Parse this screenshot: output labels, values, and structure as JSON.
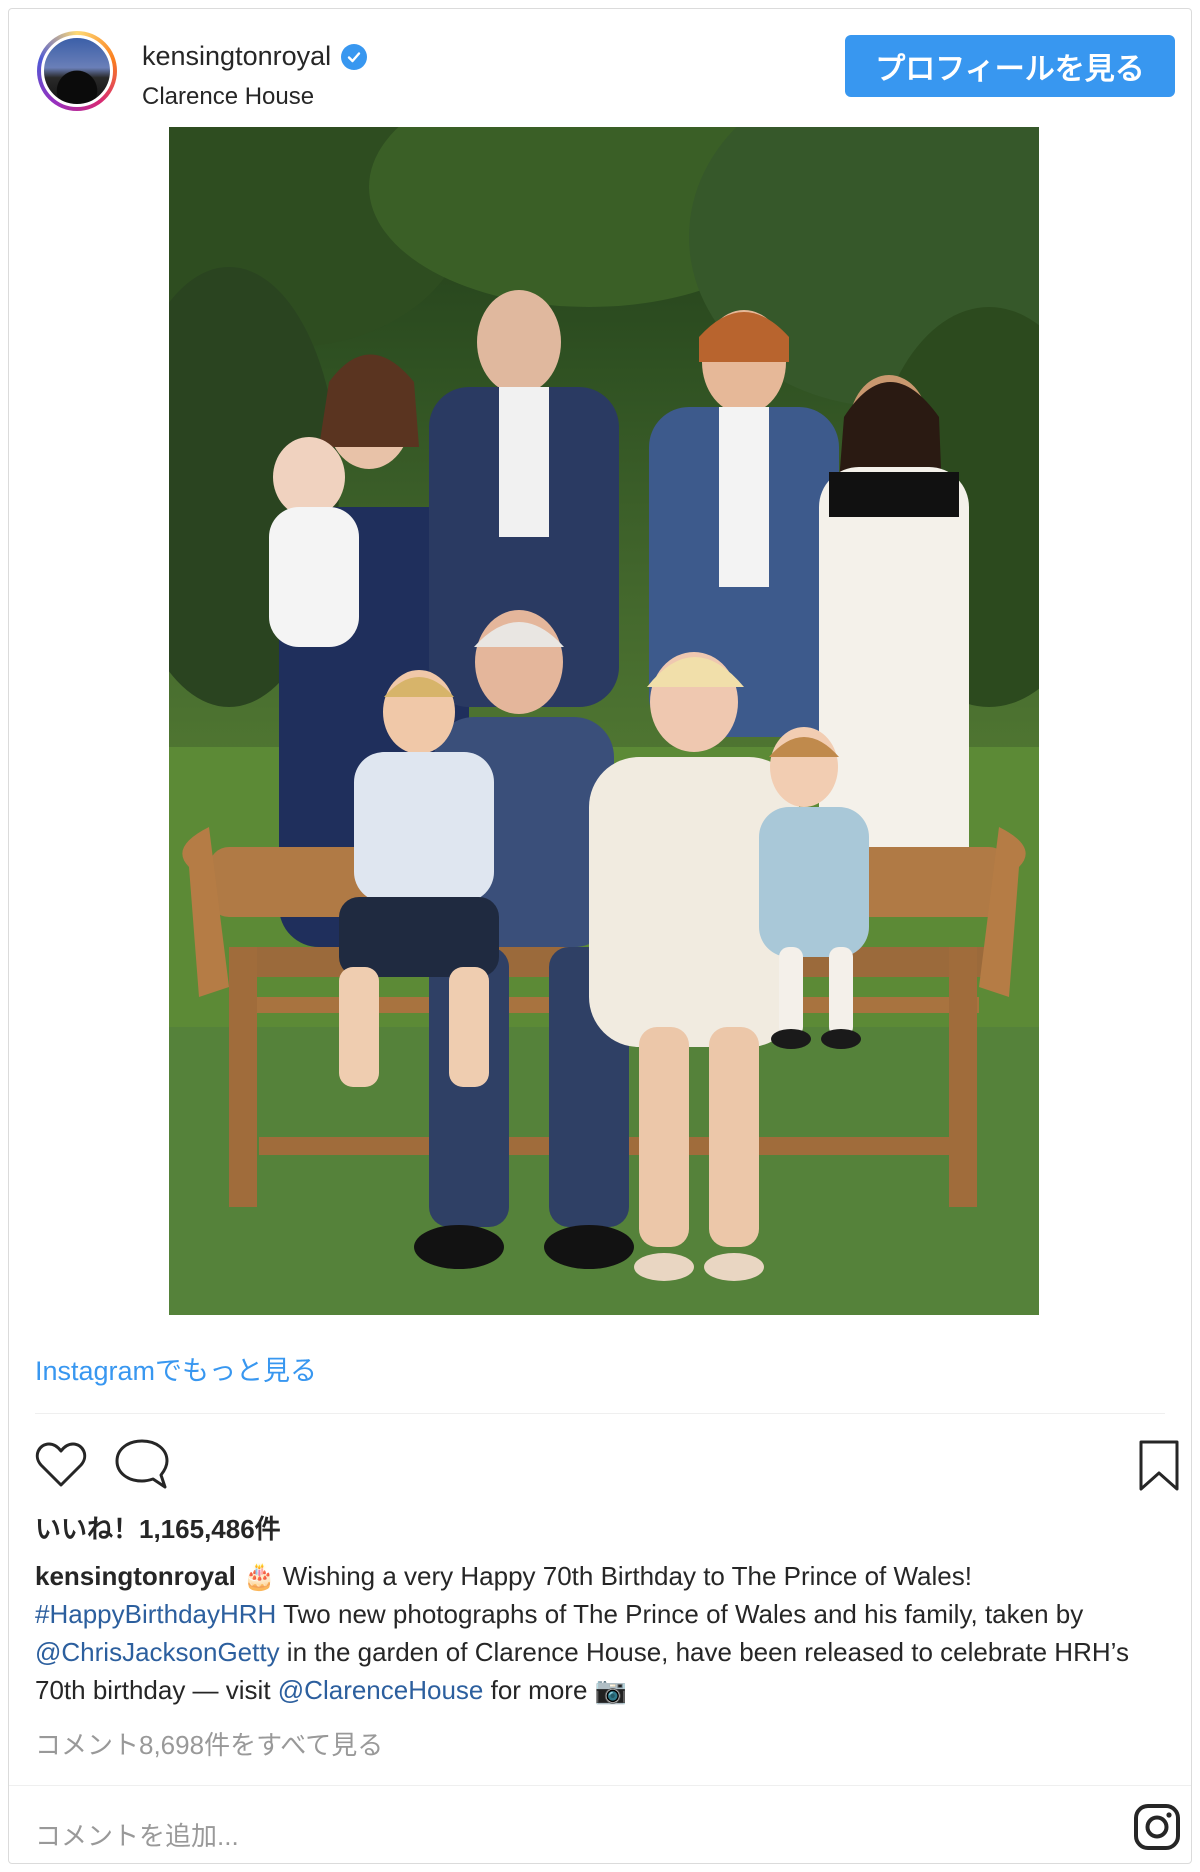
{
  "header": {
    "username": "kensingtonroyal",
    "location": "Clarence House",
    "profile_button": "プロフィールを見る"
  },
  "post": {
    "more_link": "Instagramでもっと見る",
    "likes": "いいね！1,165,486件",
    "caption": {
      "user": "kensingtonroyal",
      "cake_emoji": "🎂",
      "text1": " Wishing a very Happy 70th Birthday to The Prince of Wales! ",
      "hashtag": "#HappyBirthdayHRH",
      "text2": " Two new photographs of The Prince of Wales and his family, taken by ",
      "mention1": "@ChrisJacksonGetty",
      "text3": " in the garden of Clarence House, have been released to celebrate HRH’s 70th birthday — visit ",
      "mention2": "@ClarenceHouse",
      "text4": " for more ",
      "camera_emoji": "📷"
    },
    "view_comments": "コメント8,698件をすべて見る",
    "add_comment_placeholder": "コメントを追加..."
  },
  "icons": {
    "verified": "verified-badge-icon",
    "like": "heart-icon",
    "comment": "comment-icon",
    "save": "bookmark-icon",
    "instagram": "instagram-logo-icon"
  },
  "colors": {
    "accent": "#3897f0",
    "text": "#262626",
    "muted": "#999999",
    "mention": "#2c5f9e"
  }
}
